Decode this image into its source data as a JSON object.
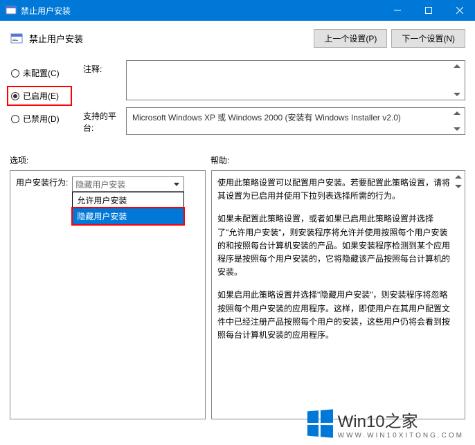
{
  "window": {
    "title": "禁止用户安装"
  },
  "header": {
    "title": "禁止用户安装",
    "prev_button": "上一个设置(P)",
    "next_button": "下一个设置(N)"
  },
  "radio": {
    "not_configured": "未配置(C)",
    "enabled": "已启用(E)",
    "disabled": "已禁用(D)",
    "selected": "enabled"
  },
  "fields": {
    "comment_label": "注释:",
    "comment_value": "",
    "platform_label": "支持的平台:",
    "platform_value": "Microsoft Windows XP 或 Windows 2000 (安装有 Windows Installer v2.0)"
  },
  "sections": {
    "options_label": "选项:",
    "help_label": "帮助:"
  },
  "options": {
    "combo_label": "用户安装行为:",
    "combo_value": "隐藏用户安装",
    "dropdown": [
      "允许用户安装",
      "隐藏用户安装"
    ]
  },
  "help": {
    "p1": "使用此策略设置可以配置用户安装。若要配置此策略设置，请将其设置为已启用并使用下拉列表选择所需的行为。",
    "p2": "如果未配置此策略设置，或者如果已启用此策略设置并选择了\"允许用户安装\"，则安装程序将允许并使用按照每个用户安装的和按照每台计算机安装的产品。如果安装程序检测到某个应用程序是按照每个用户安装的，它将隐藏该产品按照每台计算机的安装。",
    "p3": "如果启用此策略设置并选择\"隐藏用户安装\"，则安装程序将忽略按照每个用户安装的应用程序。这样，即使用户在其用户配置文件中已经注册产品按照每个用户的安装，这些用户仍将会看到按照每台计算机安装的应用程序。"
  },
  "watermark": {
    "brand": "Win10",
    "suffix": "之家",
    "url": "WWW.WIN10XITONG.COM"
  }
}
